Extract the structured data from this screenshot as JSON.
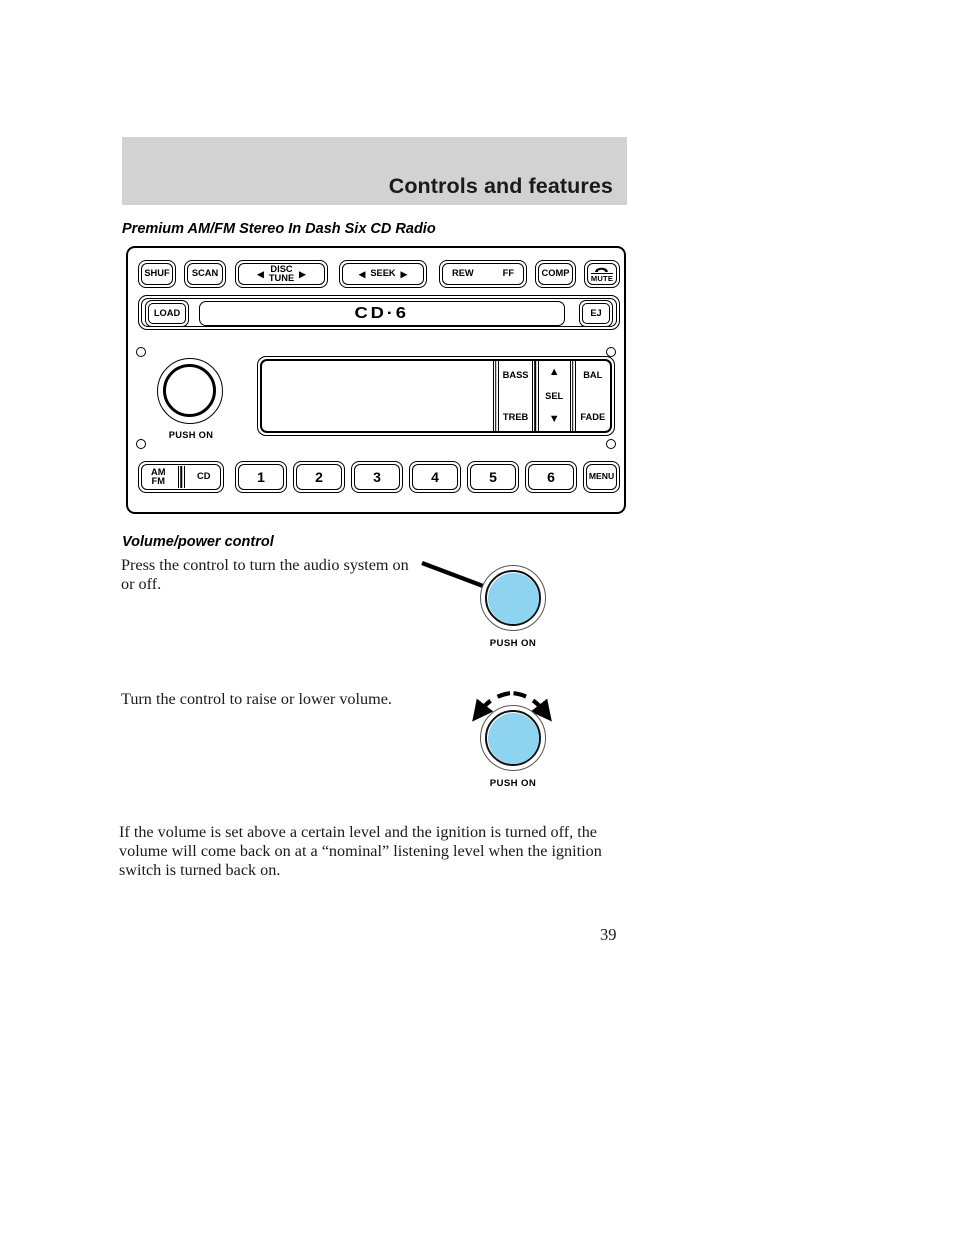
{
  "header": {
    "title": "Controls and features",
    "band_color": "#d2d2d2"
  },
  "page": {
    "number": "39"
  },
  "sections": {
    "radio_heading": "Premium AM/FM Stereo In Dash Six CD Radio",
    "volume_heading": "Volume/power control"
  },
  "radio": {
    "top_row": {
      "shuf": "SHUF",
      "scan": "SCAN",
      "disc": "DISC",
      "tune": "TUNE",
      "seek": "SEEK",
      "rew": "REW",
      "ff": "FF",
      "comp": "COMP",
      "mute": "MUTE",
      "left_arrow": "◀",
      "right_arrow": "▶",
      "handset_glyph": "☎"
    },
    "cd_strip": {
      "load": "LOAD",
      "display": "CD·6",
      "eject": "EJ"
    },
    "knob": {
      "push_on": "PUSH ON"
    },
    "display_controls": {
      "bass": "BASS",
      "treb": "TREB",
      "up_arrow": "▲",
      "sel": "SEL",
      "down_arrow": "▼",
      "bal": "BAL",
      "fade": "FADE"
    },
    "preset_row": {
      "am": "AM",
      "fm": "FM",
      "cd": "CD",
      "presets": [
        "1",
        "2",
        "3",
        "4",
        "5",
        "6"
      ],
      "menu": "MENU"
    }
  },
  "volume_section": {
    "press_text": "Press the control to turn the audio system on or off.",
    "turn_text": "Turn the control to raise or lower volume.",
    "note_text": "If the volume is set above a certain level and the ignition is turned off, the volume will come back on at a “nominal” listening level when the ignition switch is turned back on.",
    "diagram_press_caption": "PUSH ON",
    "diagram_turn_caption": "PUSH ON",
    "knob_color": "#8ed3f0"
  }
}
